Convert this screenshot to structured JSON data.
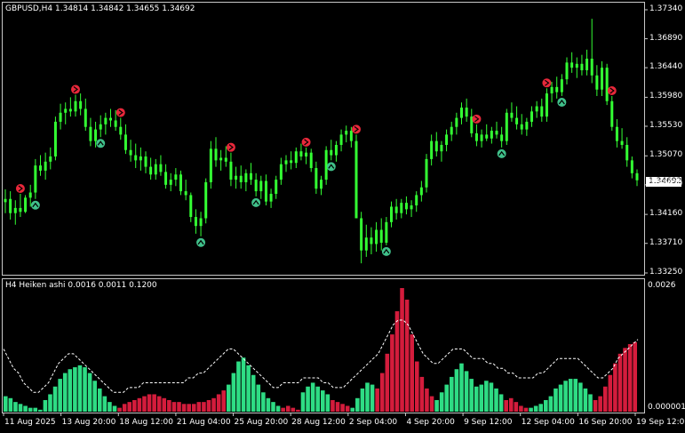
{
  "main": {
    "title": "GBPUSD,H4  1.34814 1.34842 1.34655 1.34692",
    "current_price": "1.34692",
    "price_labels": [
      "1.37340",
      "1.36890",
      "1.36440",
      "1.35980",
      "1.35530",
      "1.35070",
      "1.34620",
      "1.34160",
      "1.33710",
      "1.33250"
    ],
    "colors": {
      "bull": "#33ff33",
      "bear": "#33ff33",
      "sell_arrow": "#e8283a",
      "buy_arrow": "#40c08a",
      "frame": "#cccccc",
      "background": "#000000",
      "price_tag_bg": "#ffffff"
    },
    "price_scale": {
      "min": 1.3325,
      "max": 1.3734
    },
    "candles": [
      [
        1.3435,
        1.3455,
        1.3418,
        1.344
      ],
      [
        1.344,
        1.3452,
        1.3408,
        1.3418
      ],
      [
        1.3418,
        1.3438,
        1.34,
        1.3426
      ],
      [
        1.3426,
        1.3448,
        1.3412,
        1.342
      ],
      [
        1.342,
        1.3446,
        1.3418,
        1.3442
      ],
      [
        1.3442,
        1.3462,
        1.3428,
        1.345
      ],
      [
        1.345,
        1.3502,
        1.344,
        1.3492
      ],
      [
        1.3492,
        1.3508,
        1.3476,
        1.3484
      ],
      [
        1.3484,
        1.3512,
        1.347,
        1.3498
      ],
      [
        1.3498,
        1.352,
        1.3486,
        1.3506
      ],
      [
        1.3506,
        1.3568,
        1.35,
        1.356
      ],
      [
        1.356,
        1.3588,
        1.3548,
        1.3574
      ],
      [
        1.3574,
        1.359,
        1.3556,
        1.358
      ],
      [
        1.358,
        1.3598,
        1.3568,
        1.3576
      ],
      [
        1.3576,
        1.3602,
        1.3568,
        1.3592
      ],
      [
        1.3592,
        1.3604,
        1.357,
        1.358
      ],
      [
        1.358,
        1.3596,
        1.3546,
        1.3552
      ],
      [
        1.3552,
        1.3566,
        1.3522,
        1.353
      ],
      [
        1.353,
        1.356,
        1.352,
        1.3548
      ],
      [
        1.3548,
        1.357,
        1.3536,
        1.3556
      ],
      [
        1.3556,
        1.3574,
        1.354,
        1.3566
      ],
      [
        1.3566,
        1.358,
        1.3552,
        1.3562
      ],
      [
        1.3562,
        1.3578,
        1.3546,
        1.3552
      ],
      [
        1.3552,
        1.3566,
        1.3532,
        1.354
      ],
      [
        1.354,
        1.3556,
        1.351,
        1.3516
      ],
      [
        1.3516,
        1.3532,
        1.3498,
        1.3508
      ],
      [
        1.3508,
        1.3526,
        1.3488,
        1.35
      ],
      [
        1.35,
        1.352,
        1.3484,
        1.3506
      ],
      [
        1.3506,
        1.3514,
        1.348,
        1.349
      ],
      [
        1.349,
        1.3504,
        1.347,
        1.3478
      ],
      [
        1.3478,
        1.3502,
        1.347,
        1.3494
      ],
      [
        1.3494,
        1.3508,
        1.3476,
        1.3482
      ],
      [
        1.3482,
        1.3494,
        1.3456,
        1.3462
      ],
      [
        1.3462,
        1.348,
        1.3452,
        1.347
      ],
      [
        1.347,
        1.3488,
        1.346,
        1.3478
      ],
      [
        1.3478,
        1.3484,
        1.3446,
        1.3452
      ],
      [
        1.3452,
        1.347,
        1.3438,
        1.3446
      ],
      [
        1.3446,
        1.345,
        1.3404,
        1.3412
      ],
      [
        1.3412,
        1.3424,
        1.3386,
        1.3398
      ],
      [
        1.3398,
        1.342,
        1.3382,
        1.341
      ],
      [
        1.341,
        1.3472,
        1.3402,
        1.3466
      ],
      [
        1.3466,
        1.353,
        1.3456,
        1.3518
      ],
      [
        1.3518,
        1.3536,
        1.349,
        1.35
      ],
      [
        1.35,
        1.3516,
        1.3484,
        1.3504
      ],
      [
        1.3504,
        1.3522,
        1.349,
        1.3498
      ],
      [
        1.3498,
        1.3512,
        1.346,
        1.347
      ],
      [
        1.347,
        1.349,
        1.3456,
        1.3476
      ],
      [
        1.3476,
        1.3492,
        1.3456,
        1.3466
      ],
      [
        1.3466,
        1.3486,
        1.3452,
        1.348
      ],
      [
        1.348,
        1.3496,
        1.3462,
        1.347
      ],
      [
        1.347,
        1.348,
        1.3444,
        1.3452
      ],
      [
        1.3452,
        1.3476,
        1.344,
        1.3468
      ],
      [
        1.3468,
        1.3478,
        1.343,
        1.3436
      ],
      [
        1.3436,
        1.3456,
        1.3426,
        1.3448
      ],
      [
        1.3448,
        1.3476,
        1.344,
        1.347
      ],
      [
        1.347,
        1.3504,
        1.3462,
        1.3494
      ],
      [
        1.3494,
        1.3508,
        1.3482,
        1.35
      ],
      [
        1.35,
        1.3514,
        1.3486,
        1.3496
      ],
      [
        1.3496,
        1.352,
        1.3488,
        1.3514
      ],
      [
        1.3514,
        1.3526,
        1.35,
        1.3506
      ],
      [
        1.3506,
        1.352,
        1.3494,
        1.3512
      ],
      [
        1.3512,
        1.3518,
        1.3482,
        1.3488
      ],
      [
        1.3488,
        1.3498,
        1.3448,
        1.3456
      ],
      [
        1.3456,
        1.3476,
        1.3446,
        1.347
      ],
      [
        1.347,
        1.3522,
        1.3462,
        1.3516
      ],
      [
        1.3516,
        1.3532,
        1.35,
        1.3508
      ],
      [
        1.3508,
        1.353,
        1.3498,
        1.3524
      ],
      [
        1.3524,
        1.3548,
        1.3514,
        1.354
      ],
      [
        1.354,
        1.3554,
        1.3528,
        1.3546
      ],
      [
        1.3546,
        1.3552,
        1.352,
        1.353
      ],
      [
        1.353,
        1.354,
        1.344,
        1.341
      ],
      [
        1.341,
        1.342,
        1.334,
        1.336
      ],
      [
        1.336,
        1.34,
        1.335,
        1.338
      ],
      [
        1.338,
        1.3396,
        1.3354,
        1.337
      ],
      [
        1.337,
        1.3404,
        1.3358,
        1.3392
      ],
      [
        1.3392,
        1.341,
        1.336,
        1.3372
      ],
      [
        1.3372,
        1.3412,
        1.3368,
        1.3404
      ],
      [
        1.3404,
        1.3436,
        1.3396,
        1.3428
      ],
      [
        1.3428,
        1.344,
        1.3408,
        1.3418
      ],
      [
        1.3418,
        1.344,
        1.341,
        1.3434
      ],
      [
        1.3434,
        1.3444,
        1.3416,
        1.3424
      ],
      [
        1.3424,
        1.3438,
        1.3412,
        1.343
      ],
      [
        1.343,
        1.3452,
        1.342,
        1.3446
      ],
      [
        1.3446,
        1.3468,
        1.3436,
        1.3458
      ],
      [
        1.3458,
        1.351,
        1.345,
        1.3502
      ],
      [
        1.3502,
        1.354,
        1.3492,
        1.353
      ],
      [
        1.353,
        1.3544,
        1.3506,
        1.3514
      ],
      [
        1.3514,
        1.353,
        1.3498,
        1.3524
      ],
      [
        1.3524,
        1.3548,
        1.3514,
        1.354
      ],
      [
        1.354,
        1.356,
        1.353,
        1.3552
      ],
      [
        1.3552,
        1.3574,
        1.354,
        1.3566
      ],
      [
        1.3566,
        1.359,
        1.3556,
        1.3582
      ],
      [
        1.3582,
        1.3596,
        1.356,
        1.3568
      ],
      [
        1.3568,
        1.358,
        1.3536,
        1.3542
      ],
      [
        1.3542,
        1.3556,
        1.3522,
        1.353
      ],
      [
        1.353,
        1.3548,
        1.352,
        1.354
      ],
      [
        1.354,
        1.3556,
        1.353,
        1.3534
      ],
      [
        1.3534,
        1.3552,
        1.3526,
        1.3546
      ],
      [
        1.3546,
        1.356,
        1.3534,
        1.354
      ],
      [
        1.354,
        1.3552,
        1.352,
        1.353
      ],
      [
        1.353,
        1.358,
        1.3524,
        1.3574
      ],
      [
        1.3574,
        1.359,
        1.356,
        1.3566
      ],
      [
        1.3566,
        1.3584,
        1.3548,
        1.3556
      ],
      [
        1.3556,
        1.3572,
        1.354,
        1.3548
      ],
      [
        1.3548,
        1.3566,
        1.3538,
        1.356
      ],
      [
        1.356,
        1.3584,
        1.3552,
        1.3576
      ],
      [
        1.3576,
        1.3592,
        1.3566,
        1.3584
      ],
      [
        1.3584,
        1.3596,
        1.356,
        1.3568
      ],
      [
        1.3568,
        1.3612,
        1.356,
        1.3604
      ],
      [
        1.3604,
        1.3622,
        1.359,
        1.3614
      ],
      [
        1.3614,
        1.363,
        1.3596,
        1.3606
      ],
      [
        1.3606,
        1.3634,
        1.36,
        1.3626
      ],
      [
        1.3626,
        1.366,
        1.3618,
        1.3652
      ],
      [
        1.3652,
        1.3668,
        1.3636,
        1.3644
      ],
      [
        1.3644,
        1.366,
        1.3628,
        1.365
      ],
      [
        1.365,
        1.3664,
        1.3632,
        1.364
      ],
      [
        1.364,
        1.3672,
        1.3632,
        1.3658
      ],
      [
        1.3658,
        1.372,
        1.362,
        1.3632
      ],
      [
        1.3632,
        1.3648,
        1.36,
        1.361
      ],
      [
        1.361,
        1.3654,
        1.36,
        1.3644
      ],
      [
        1.3644,
        1.365,
        1.3586,
        1.3592
      ],
      [
        1.3592,
        1.36,
        1.3546,
        1.3552
      ],
      [
        1.3552,
        1.3564,
        1.352,
        1.353
      ],
      [
        1.353,
        1.355,
        1.3518,
        1.3524
      ],
      [
        1.3524,
        1.3536,
        1.349,
        1.35
      ],
      [
        1.35,
        1.3506,
        1.3472,
        1.348
      ],
      [
        1.348,
        1.3486,
        1.346,
        1.3469
      ]
    ],
    "sell_signals": [
      3,
      14,
      23,
      45,
      60,
      70,
      94,
      108,
      121
    ],
    "buy_signals": [
      6,
      19,
      39,
      50,
      65,
      76,
      99,
      111
    ]
  },
  "indicator": {
    "title": "H4 Heiken ashi  0.0016 0.0011 0.1200",
    "scale_top": "0.0026",
    "scale_bottom": "0.000001",
    "scale": {
      "min": 0,
      "max": 0.0026
    },
    "colors": {
      "up": "#2edc84",
      "down": "#d41c3c",
      "signal": "#ffffff"
    },
    "bars": [
      [
        8,
        1
      ],
      [
        7,
        1
      ],
      [
        5,
        1
      ],
      [
        4,
        1
      ],
      [
        3,
        1
      ],
      [
        2,
        1
      ],
      [
        2,
        1
      ],
      [
        1,
        1
      ],
      [
        6,
        1
      ],
      [
        9,
        1
      ],
      [
        13,
        1
      ],
      [
        17,
        1
      ],
      [
        20,
        1
      ],
      [
        22,
        1
      ],
      [
        23,
        1
      ],
      [
        24,
        1
      ],
      [
        23,
        1
      ],
      [
        20,
        1
      ],
      [
        16,
        1
      ],
      [
        12,
        1
      ],
      [
        8,
        1
      ],
      [
        5,
        1
      ],
      [
        3,
        1
      ],
      [
        2,
        0
      ],
      [
        4,
        0
      ],
      [
        5,
        0
      ],
      [
        6,
        0
      ],
      [
        7,
        0
      ],
      [
        8,
        0
      ],
      [
        9,
        0
      ],
      [
        9,
        0
      ],
      [
        8,
        0
      ],
      [
        7,
        0
      ],
      [
        6,
        0
      ],
      [
        5,
        0
      ],
      [
        5,
        0
      ],
      [
        4,
        0
      ],
      [
        4,
        0
      ],
      [
        4,
        0
      ],
      [
        5,
        0
      ],
      [
        5,
        0
      ],
      [
        6,
        0
      ],
      [
        7,
        0
      ],
      [
        9,
        0
      ],
      [
        11,
        0
      ],
      [
        14,
        1
      ],
      [
        20,
        1
      ],
      [
        26,
        1
      ],
      [
        28,
        1
      ],
      [
        24,
        1
      ],
      [
        19,
        1
      ],
      [
        14,
        1
      ],
      [
        10,
        1
      ],
      [
        7,
        1
      ],
      [
        5,
        1
      ],
      [
        3,
        1
      ],
      [
        2,
        0
      ],
      [
        3,
        0
      ],
      [
        2,
        0
      ],
      [
        1,
        0
      ],
      [
        10,
        1
      ],
      [
        13,
        1
      ],
      [
        15,
        1
      ],
      [
        13,
        1
      ],
      [
        11,
        1
      ],
      [
        9,
        1
      ],
      [
        6,
        0
      ],
      [
        5,
        0
      ],
      [
        4,
        0
      ],
      [
        3,
        0
      ],
      [
        2,
        1
      ],
      [
        7,
        1
      ],
      [
        12,
        1
      ],
      [
        15,
        1
      ],
      [
        14,
        1
      ],
      [
        12,
        0
      ],
      [
        20,
        0
      ],
      [
        30,
        0
      ],
      [
        40,
        0
      ],
      [
        52,
        0
      ],
      [
        64,
        0
      ],
      [
        58,
        0
      ],
      [
        40,
        0
      ],
      [
        26,
        0
      ],
      [
        18,
        0
      ],
      [
        12,
        0
      ],
      [
        8,
        0
      ],
      [
        6,
        1
      ],
      [
        10,
        1
      ],
      [
        14,
        1
      ],
      [
        18,
        1
      ],
      [
        22,
        1
      ],
      [
        25,
        1
      ],
      [
        21,
        1
      ],
      [
        17,
        1
      ],
      [
        13,
        1
      ],
      [
        14,
        1
      ],
      [
        16,
        1
      ],
      [
        15,
        1
      ],
      [
        12,
        1
      ],
      [
        9,
        1
      ],
      [
        6,
        0
      ],
      [
        7,
        0
      ],
      [
        5,
        0
      ],
      [
        3,
        0
      ],
      [
        2,
        0
      ],
      [
        2,
        1
      ],
      [
        3,
        1
      ],
      [
        4,
        1
      ],
      [
        6,
        1
      ],
      [
        8,
        1
      ],
      [
        12,
        1
      ],
      [
        14,
        1
      ],
      [
        16,
        1
      ],
      [
        17,
        1
      ],
      [
        17,
        1
      ],
      [
        15,
        1
      ],
      [
        12,
        1
      ],
      [
        9,
        1
      ],
      [
        6,
        0
      ],
      [
        8,
        0
      ],
      [
        13,
        0
      ],
      [
        19,
        0
      ],
      [
        25,
        0
      ],
      [
        30,
        0
      ],
      [
        33,
        0
      ],
      [
        35,
        0
      ],
      [
        36,
        0
      ]
    ],
    "signal_line": [
      0.0013,
      0.0011,
      0.0009,
      0.0008,
      0.0006,
      0.0005,
      0.0004,
      0.0004,
      0.0005,
      0.0006,
      0.0008,
      0.001,
      0.0011,
      0.0012,
      0.0012,
      0.0011,
      0.001,
      0.0009,
      0.0008,
      0.0007,
      0.0006,
      0.0005,
      0.0004,
      0.0004,
      0.0004,
      0.0005,
      0.0005,
      0.0005,
      0.0006,
      0.0006,
      0.0006,
      0.0006,
      0.0006,
      0.0006,
      0.0006,
      0.0006,
      0.0006,
      0.0007,
      0.0007,
      0.0008,
      0.0008,
      0.0009,
      0.001,
      0.0011,
      0.0012,
      0.0013,
      0.0013,
      0.0012,
      0.0011,
      0.001,
      0.0009,
      0.0008,
      0.0007,
      0.0006,
      0.0005,
      0.0005,
      0.0006,
      0.0006,
      0.0006,
      0.0006,
      0.0007,
      0.0007,
      0.0007,
      0.0007,
      0.0006,
      0.0006,
      0.0005,
      0.0005,
      0.0005,
      0.0006,
      0.0007,
      0.0008,
      0.0009,
      0.001,
      0.0011,
      0.0012,
      0.0014,
      0.0016,
      0.0018,
      0.0019,
      0.0019,
      0.0018,
      0.0016,
      0.0014,
      0.0012,
      0.0011,
      0.001,
      0.001,
      0.0011,
      0.0012,
      0.0013,
      0.0013,
      0.0013,
      0.0012,
      0.0011,
      0.0011,
      0.0011,
      0.001,
      0.001,
      0.0009,
      0.0009,
      0.0008,
      0.0008,
      0.0007,
      0.0007,
      0.0007,
      0.0007,
      0.0008,
      0.0008,
      0.0009,
      0.001,
      0.0011,
      0.0011,
      0.0011,
      0.0011,
      0.0011,
      0.001,
      0.0009,
      0.0008,
      0.0007,
      0.0007,
      0.0008,
      0.0009,
      0.0011,
      0.0012,
      0.0013,
      0.0014,
      0.0015
    ]
  },
  "time_axis": {
    "labels": [
      "11 Aug 2025",
      "13 Aug 20:00",
      "18 Aug 12:00",
      "21 Aug 04:00",
      "25 Aug 20:00",
      "28 Aug 12:00",
      "2 Sep 04:00",
      "4 Sep 20:00",
      "9 Sep 12:00",
      "12 Sep 04:00",
      "16 Sep 20:00",
      "19 Sep 12:00"
    ]
  }
}
